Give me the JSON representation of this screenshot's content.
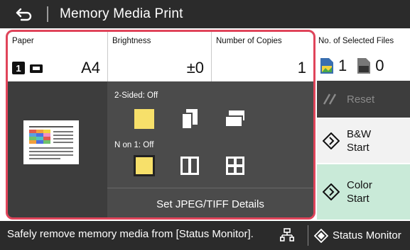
{
  "header": {
    "title": "Memory Media Print"
  },
  "settings": {
    "paper": {
      "label": "Paper",
      "tray": "1",
      "value": "A4"
    },
    "brightness": {
      "label": "Brightness",
      "value": "±0"
    },
    "copies": {
      "label": "Number of Copies",
      "value": "1"
    }
  },
  "options": {
    "two_sided": {
      "label": "2-Sided: Off"
    },
    "n_on_1": {
      "label": "N on 1: Off"
    },
    "details_label": "Set JPEG/TIFF Details"
  },
  "files": {
    "label": "No. of Selected Files",
    "image_count": "1",
    "doc_count": "0"
  },
  "buttons": {
    "reset": "Reset",
    "bw_line1": "B&W",
    "bw_line2": "Start",
    "color_line1": "Color",
    "color_line2": "Start"
  },
  "status": {
    "message": "Safely remove memory media from [Status Monitor].",
    "monitor_label": "Status Monitor"
  },
  "colors": {
    "accent_border": "#e0445a",
    "selected_yellow": "#f7e06a",
    "color_start_bg": "#c9ead8",
    "title_bar": "#2b2b2b"
  }
}
